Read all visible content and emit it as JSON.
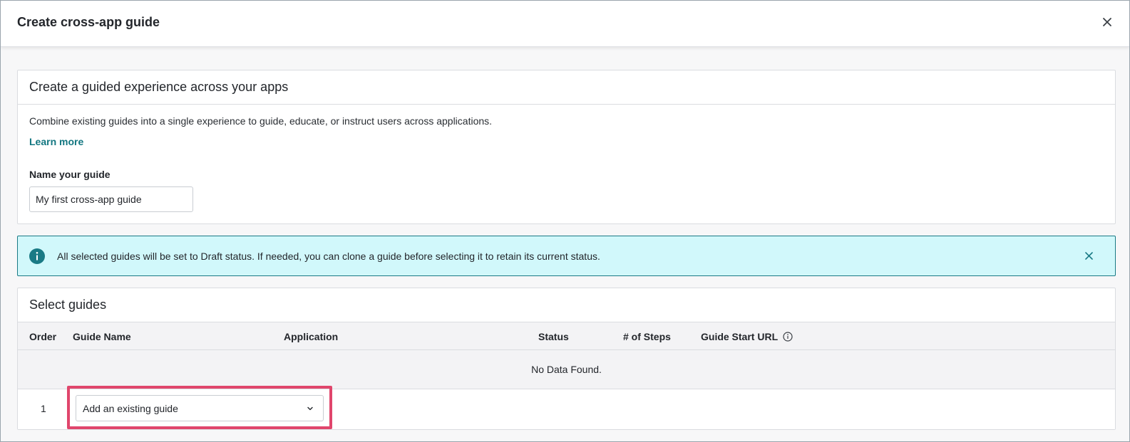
{
  "modal": {
    "title": "Create cross-app guide",
    "close_icon": "close-icon"
  },
  "intro": {
    "heading": "Create a guided experience across your apps",
    "description": "Combine existing guides into a single experience to guide, educate, or instruct users across applications.",
    "learn_more": "Learn more",
    "name_label": "Name your guide",
    "name_value": "My first cross-app guide"
  },
  "alert": {
    "icon": "info-icon",
    "text": "All selected guides will be set to Draft status. If needed, you can clone a guide before selecting it to retain its current status.",
    "close_icon": "close-icon"
  },
  "select_guides": {
    "heading": "Select guides",
    "columns": [
      "Order",
      "Guide Name",
      "Application",
      "Status",
      "# of Steps",
      "Guide Start URL"
    ],
    "empty_text": "No Data Found.",
    "row": {
      "order": "1",
      "select_value": "Add an existing guide"
    }
  },
  "colors": {
    "accent": "#127680",
    "alert_bg": "#d1f8fb",
    "highlight": "#e0466c"
  }
}
